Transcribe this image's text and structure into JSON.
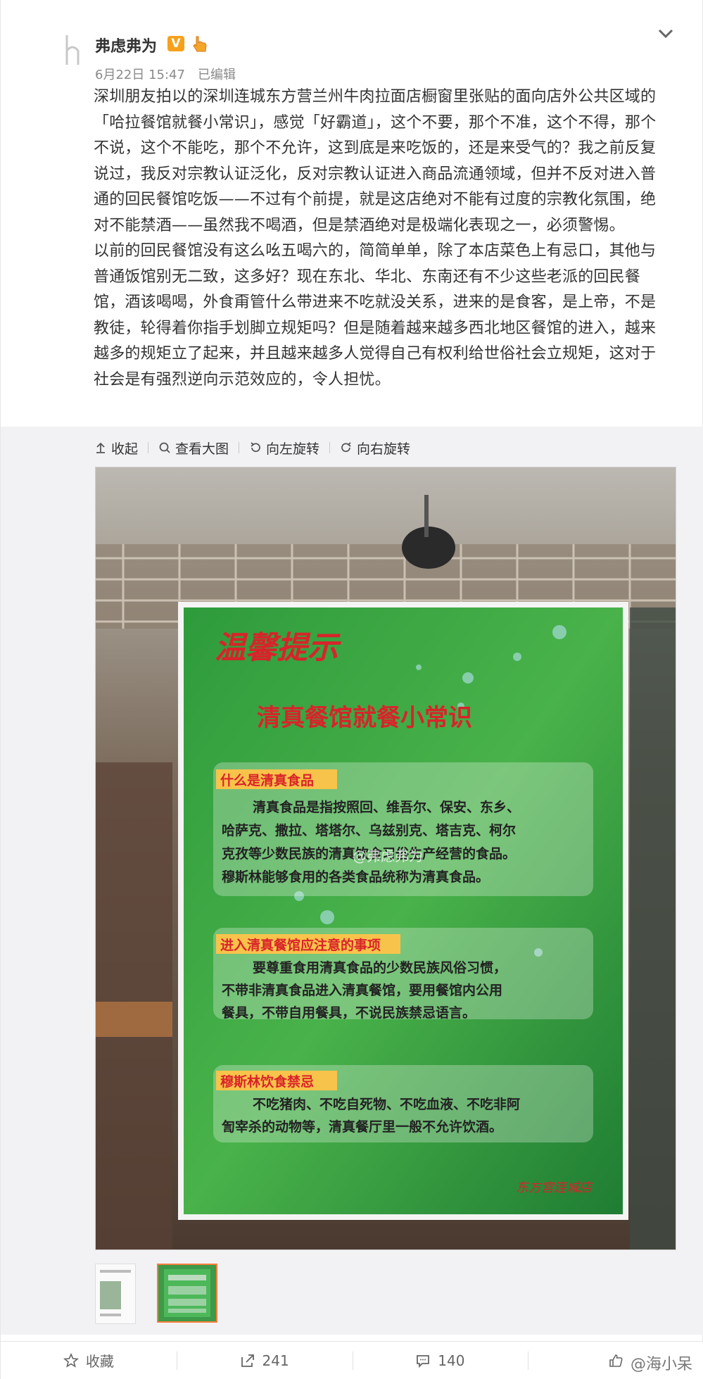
{
  "post": {
    "username": "弗虑弗为",
    "verified_badge": "V",
    "date": "6月22日 15:47",
    "edited": "已编辑",
    "paragraphs": [
      "深圳朋友拍以的深圳连城东方营兰州牛肉拉面店橱窗里张贴的面向店外公共区域的「哈拉餐馆就餐小常识」，感觉「好霸道」，这个不要，那个不准，这个不得，那个不说，这个不能吃，那个不允许，这到底是来吃饭的，还是来受气的？我之前反复说过，我反对宗教认证泛化，反对宗教认证进入商品流通领域，但并不反对进入普通的回民餐馆吃饭——不过有个前提，就是这店绝对不能有过度的宗教化氛围，绝对不能禁酒——虽然我不喝酒，但是禁酒绝对是极端化表现之一，必须警惕。",
      "以前的回民餐馆没有这么吆五喝六的，简简单单，除了本店菜色上有忌口，其他与普通饭馆别无二致，这多好？现在东北、华北、东南还有不少这些老派的回民餐馆，酒该喝喝，外食甭管什么带进来不吃就没关系，进来的是食客，是上帝，不是教徒，轮得着你指手划脚立规矩吗？但是随着越来越多西北地区餐馆的进入，越来越多的规矩立了起来，并且越来越多人觉得自己有权利给世俗社会立规矩，这对于社会是有强烈逆向示范效应的，令人担忧。"
    ]
  },
  "toolbar": {
    "collapse": "收起",
    "view_large": "查看大图",
    "rotate_left": "向左旋转",
    "rotate_right": "向右旋转"
  },
  "photo": {
    "poster_banner": "温馨提示",
    "poster_title": "清真餐馆就餐小常识",
    "sections": [
      {
        "heading": "什么是清真食品",
        "lines": [
          "清真食品是指按照回、维吾尔、保安、东乡、",
          "哈萨克、撒拉、塔塔尔、乌兹别克、塔吉克、柯尔",
          "克孜等少数民族的清真饮食习俗生产经营的食品。",
          "穆斯林能够食用的各类食品统称为清真食品。"
        ]
      },
      {
        "heading": "进入清真餐馆应注意的事项",
        "lines": [
          "要尊重食用清真食品的少数民族风俗习惯，",
          "不带非清真食品进入清真餐馆，要用餐馆内公用",
          "餐具，不带自用餐具，不说民族禁忌语言。"
        ]
      },
      {
        "heading": "穆斯林饮食禁忌",
        "lines": [
          "不吃猪肉、不吃自死物、不吃血液、不吃非阿",
          "訇宰杀的动物等，清真餐厅里一般不允许饮酒。"
        ]
      }
    ],
    "poster_footer": "东方宫连城店",
    "watermark": "@弗虑弗为"
  },
  "actions": {
    "favorite": "收藏",
    "repost_count": "241",
    "comment_count": "140"
  },
  "bottom_watermark": "@海小呆",
  "colors": {
    "accent_orange": "#fa7d3c",
    "poster_green": "#2f8f3a",
    "poster_red": "#d9232a"
  }
}
